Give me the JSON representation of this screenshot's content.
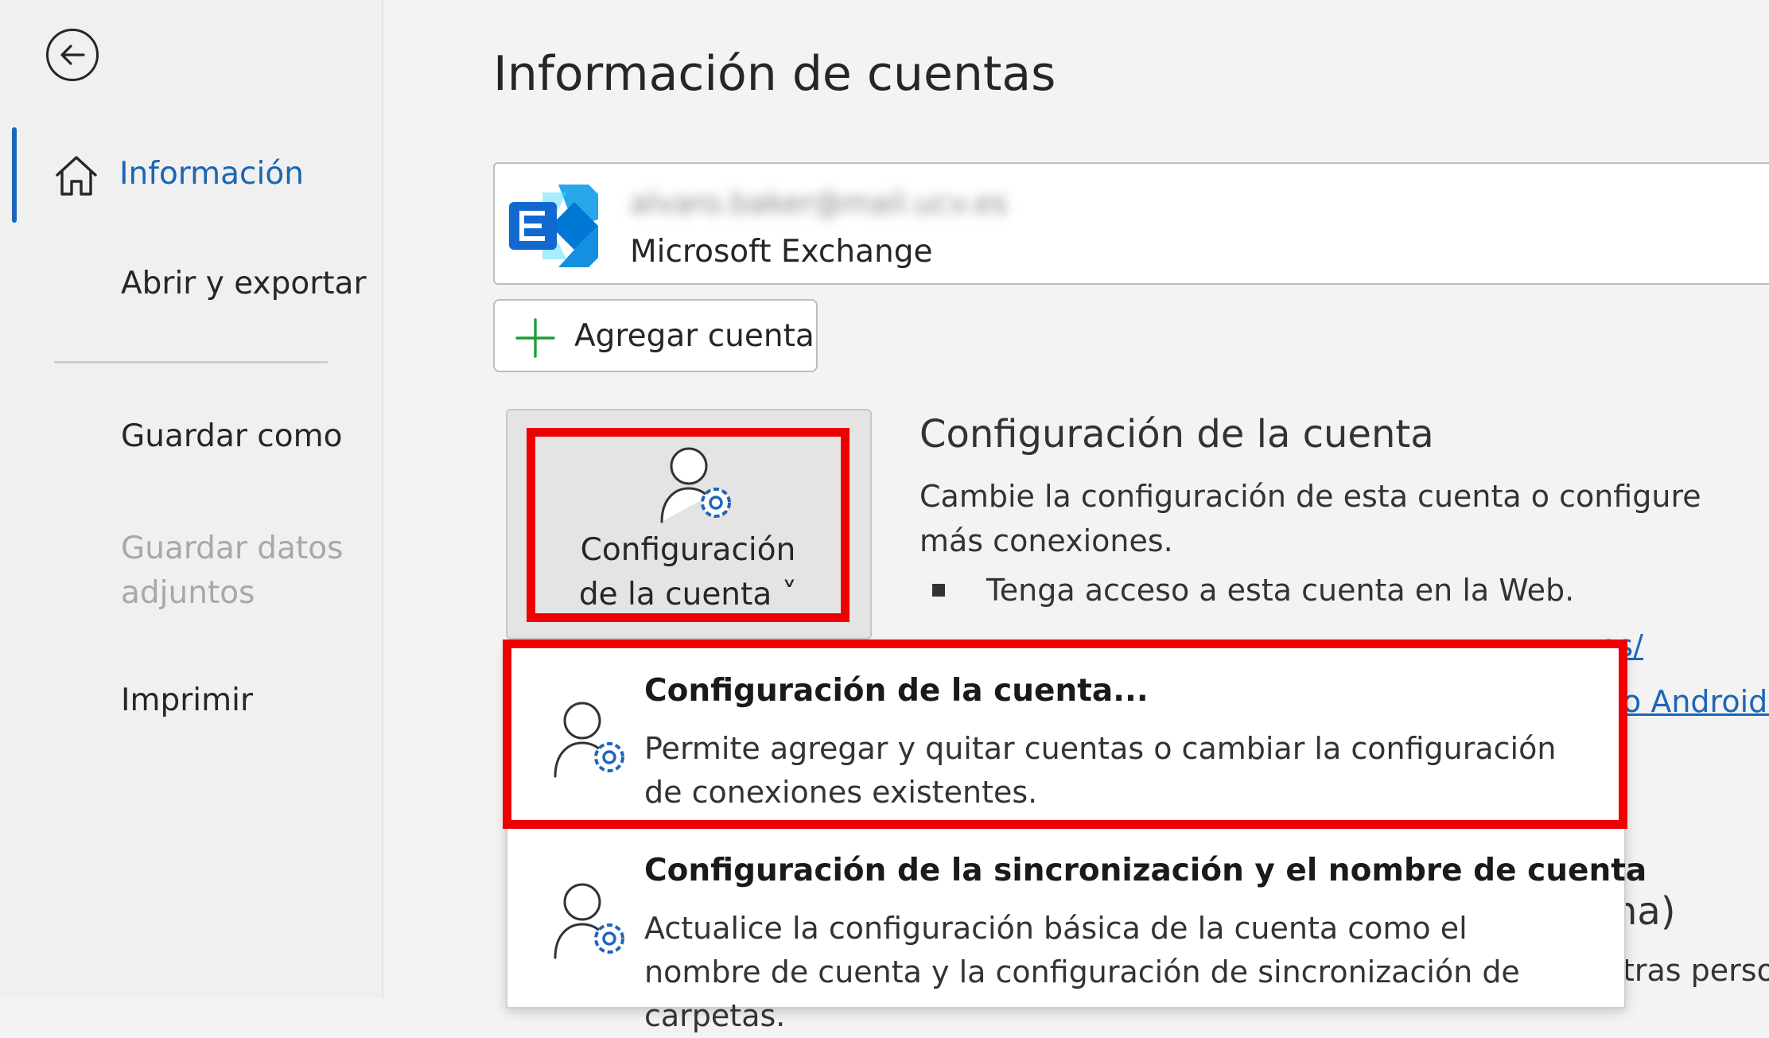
{
  "nav": {
    "items": [
      {
        "label": "Información",
        "selected": true
      },
      {
        "label": "Abrir y exportar"
      },
      {
        "label": "Guardar como"
      },
      {
        "label": "Guardar datos adjuntos",
        "disabled": true
      },
      {
        "label": "Imprimir"
      }
    ]
  },
  "main": {
    "title": "Información de cuentas",
    "account": {
      "email": "alvaro.baker@mail.ucv.es",
      "type": "Microsoft Exchange"
    },
    "add_account_label": "Agregar cuenta",
    "account_settings_button": {
      "label_line1": "Configuración",
      "label_line2": "de la cuenta ˅"
    },
    "section": {
      "title": "Configuración de la cuenta",
      "description": "Cambie la configuración de esta cuenta o configure más conexiones.",
      "bullet": "Tenga acceso a esta cuenta en la Web.",
      "link_fragment_1": "es/",
      "link_fragment_2": "o Android.",
      "partial_heading": "na)",
      "partial_text": "tras perso"
    }
  },
  "dropdown": {
    "items": [
      {
        "title": "Configuración de la cuenta...",
        "description": "Permite agregar y quitar cuentas o cambiar la configuración de conexiones existentes."
      },
      {
        "title": "Configuración de la sincronización y el nombre de cuenta",
        "description": "Actualice la configuración básica de la cuenta como el nombre de cuenta y la configuración de sincronización de carpetas."
      }
    ]
  },
  "colors": {
    "accent": "#1a66b3",
    "highlight": "#ee0000",
    "exchange_blue": "#1169cf"
  },
  "icons": [
    "back-arrow-icon",
    "home-icon",
    "exchange-logo-icon",
    "plus-icon",
    "user-gear-icon"
  ]
}
